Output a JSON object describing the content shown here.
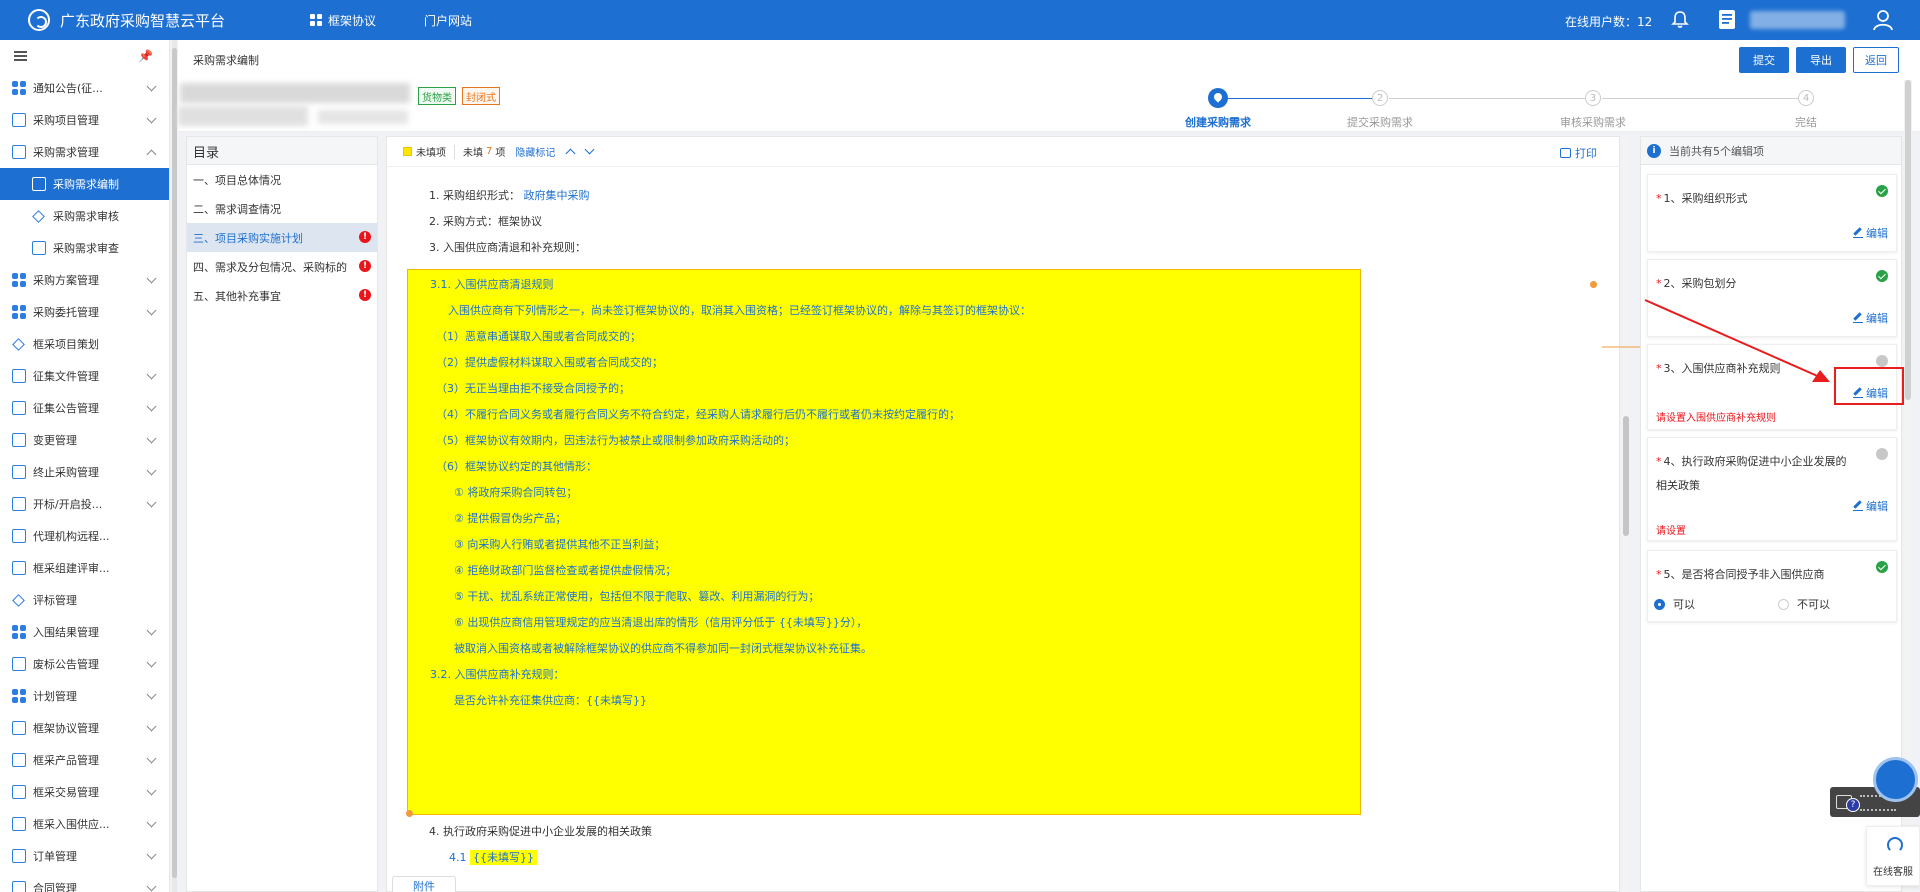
{
  "topbar": {
    "brand": "广东政府采购智慧云平台",
    "nav": [
      {
        "label": "框架协议",
        "icon": "grid-icon"
      },
      {
        "label": "门户网站"
      }
    ],
    "online_users": "在线用户数：12"
  },
  "sidebar": {
    "items": [
      {
        "label": "通知公告(征..."
      },
      {
        "label": "采购项目管理"
      },
      {
        "label": "采购需求管理"
      },
      {
        "label": "采购需求编制"
      },
      {
        "label": "采购需求审核"
      },
      {
        "label": "采购需求审查"
      },
      {
        "label": "采购方案管理"
      },
      {
        "label": "采购委托管理"
      },
      {
        "label": "框采项目策划"
      },
      {
        "label": "征集文件管理"
      },
      {
        "label": "征集公告管理"
      },
      {
        "label": "变更管理"
      },
      {
        "label": "终止采购管理"
      },
      {
        "label": "开标/开启投..."
      },
      {
        "label": "代理机构远程..."
      },
      {
        "label": "框采组建评审..."
      },
      {
        "label": "评标管理"
      },
      {
        "label": "入围结果管理"
      },
      {
        "label": "废标公告管理"
      },
      {
        "label": "计划管理"
      },
      {
        "label": "框架协议管理"
      },
      {
        "label": "框采产品管理"
      },
      {
        "label": "框采交易管理"
      },
      {
        "label": "框采入围供应..."
      },
      {
        "label": "订单管理"
      },
      {
        "label": "合同管理"
      }
    ]
  },
  "header": {
    "breadcrumb": "采购需求编制",
    "buttons": {
      "submit": "提交",
      "export": "导出",
      "back": "返回"
    }
  },
  "info": {
    "tags": [
      "货物类",
      "封闭式"
    ],
    "steps": [
      "创建采购需求",
      "提交采购需求",
      "审核采购需求",
      "完结"
    ],
    "step_numbers": [
      "2",
      "3",
      "4"
    ]
  },
  "toc": {
    "title": "目录",
    "items": [
      "一、项目总体情况",
      "二、需求调查情况",
      "三、项目采购实施计划",
      "四、需求及分包情况、采购标的",
      "五、其他补充事宜"
    ],
    "error_mark": "!"
  },
  "doc": {
    "toolbar": {
      "legend": "未填项",
      "unfilled_prefix": "未填",
      "unfilled_count": "7",
      "unfilled_suffix": "项",
      "hide_marks": "隐藏标记",
      "print": "打印"
    },
    "lines": {
      "l1_label": "1. 采购组织形式：",
      "l1_value": "政府集中采购",
      "l2": "2. 采购方式：框架协议",
      "l3": "3. 入围供应商清退和补充规则：",
      "l4": "4. 执行政府采购促进中小企业发展的相关政策",
      "l41_num": "4.1",
      "l41_value": "{{未填写}}"
    },
    "highlight": [
      "3.1. 入围供应商清退规则",
      "入围供应商有下列情形之一，尚未签订框架协议的，取消其入围资格；已经签订框架协议的，解除与其签订的框架协议：",
      "（1）恶意串通谋取入围或者合同成交的；",
      "（2）提供虚假材料谋取入围或者合同成交的；",
      "（3）无正当理由拒不接受合同授予的；",
      "（4）不履行合同义务或者履行合同义务不符合约定，经采购人请求履行后仍不履行或者仍未按约定履行的；",
      "（5）框架协议有效期内，因违法行为被禁止或限制参加政府采购活动的；",
      "（6）框架协议约定的其他情形：",
      "① 将政府采购合同转包；",
      "② 提供假冒伪劣产品；",
      "③ 向采购人行贿或者提供其他不正当利益；",
      "④ 拒绝财政部门监督检查或者提供虚假情况；",
      "⑤ 干扰、扰乱系统正常使用，包括但不限于爬取、篡改、利用漏洞的行为；",
      "⑥ 出现供应商信用管理规定的应当清退出库的情形（信用评分低于 {{未填写}}分），",
      "被取消入围资格或者被解除框架协议的供应商不得参加同一封闭式框架协议补充征集。",
      "3.2. 入围供应商补充规则：",
      "是否允许补充征集供应商：{{未填写}}"
    ],
    "attach": "附件"
  },
  "right": {
    "head": "当前共有5个编辑项",
    "edit_label": "编辑",
    "cards": [
      {
        "title": "1、采购组织形式",
        "status": "done"
      },
      {
        "title": "2、采购包划分",
        "status": "done"
      },
      {
        "title": "3、入围供应商补充规则",
        "status": "pending",
        "warn": "请设置入围供应商补充规则"
      },
      {
        "title": "4、执行政府采购促进中小企业发展的相关政策",
        "status": "pending",
        "warn": "请设置"
      },
      {
        "title": "5、是否将合同授予非入围供应商",
        "status": "done",
        "options": [
          "可以",
          "不可以"
        ],
        "selected": "可以"
      }
    ],
    "required_mark": "*"
  },
  "widgets": {
    "customer_service": "在线客服",
    "help": "?"
  }
}
